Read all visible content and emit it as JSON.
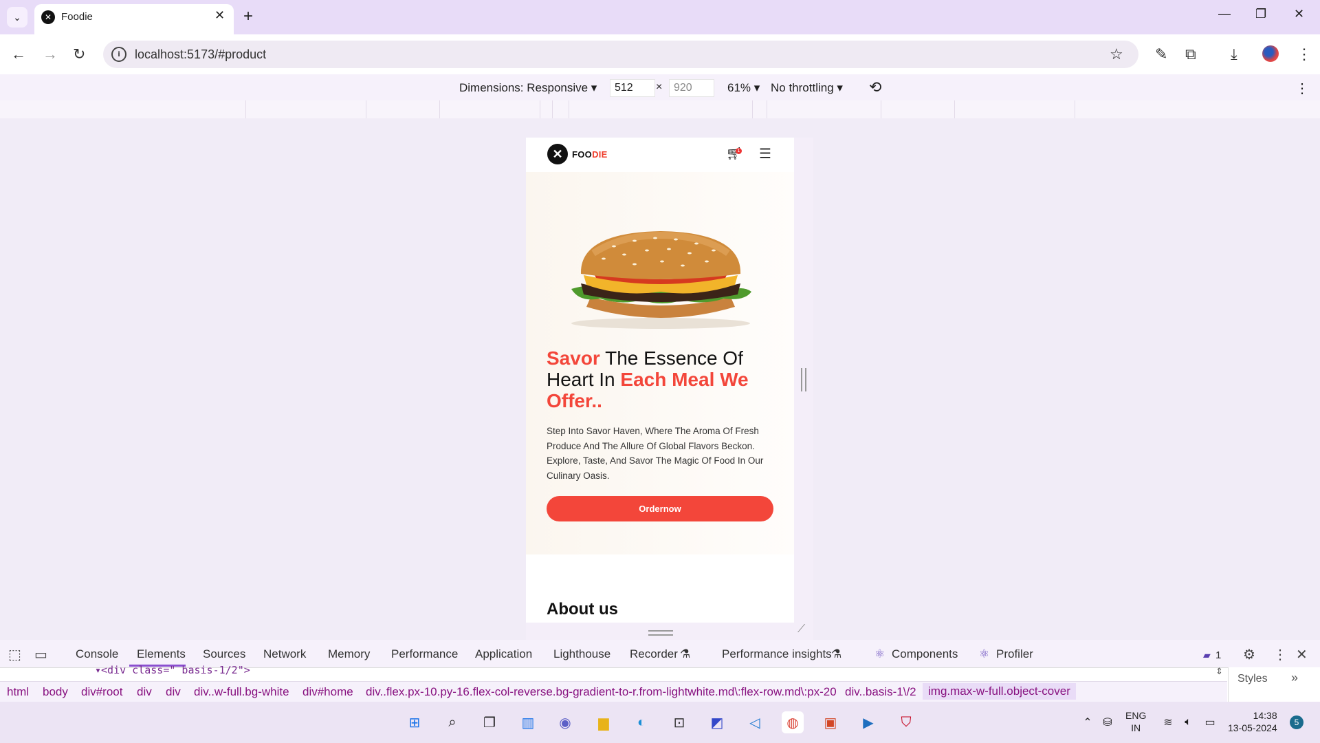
{
  "browser": {
    "tab_title": "Foodie",
    "url": "localhost:5173/#product",
    "window_controls": {
      "minimize": "—",
      "restore": "❐",
      "close": "✕"
    }
  },
  "device_toolbar": {
    "dimensions": "Dimensions: Responsive ▾",
    "width": "512",
    "height": "920",
    "times": "×",
    "zoom": "61% ▾",
    "throttling": "No throttling ▾"
  },
  "site": {
    "logo_black": "FOO",
    "logo_red": "DIE",
    "cart_count": "1",
    "headline": {
      "part1": "Savor",
      "part2": " The Essence Of Heart In ",
      "part3": "Each Meal We Offer.."
    },
    "description": "Step Into Savor Haven, Where The Aroma Of Fresh Produce And The Allure Of Global Flavors Beckon. Explore, Taste, And Savor The Magic Of Food In Our Culinary Oasis.",
    "order_button": "Ordernow",
    "about_heading": "About us"
  },
  "devtools": {
    "tabs": [
      "Console",
      "Elements",
      "Sources",
      "Network",
      "Memory",
      "Performance",
      "Application",
      "Lighthouse",
      "Recorder",
      "Performance insights",
      "Components",
      "Profiler"
    ],
    "selected_tab": "Elements",
    "issues_count": "1",
    "code_line": "<div class=\" basis-1/2\">",
    "breadcrumbs": [
      "html",
      "body",
      "div#root",
      "div",
      "div",
      "div..w-full.bg-white",
      "div#home",
      "div..flex.px-10.py-16.flex-col-reverse.bg-gradient-to-r.from-lightwhite.md\\:flex-row.md\\:px-20",
      "div..basis-1\\/2",
      "img.max-w-full.object-cover"
    ],
    "styles_tab": "Styles"
  },
  "taskbar": {
    "lang": "ENG",
    "region": "IN",
    "time": "14:38",
    "date": "13-05-2024",
    "notifications": "5"
  }
}
